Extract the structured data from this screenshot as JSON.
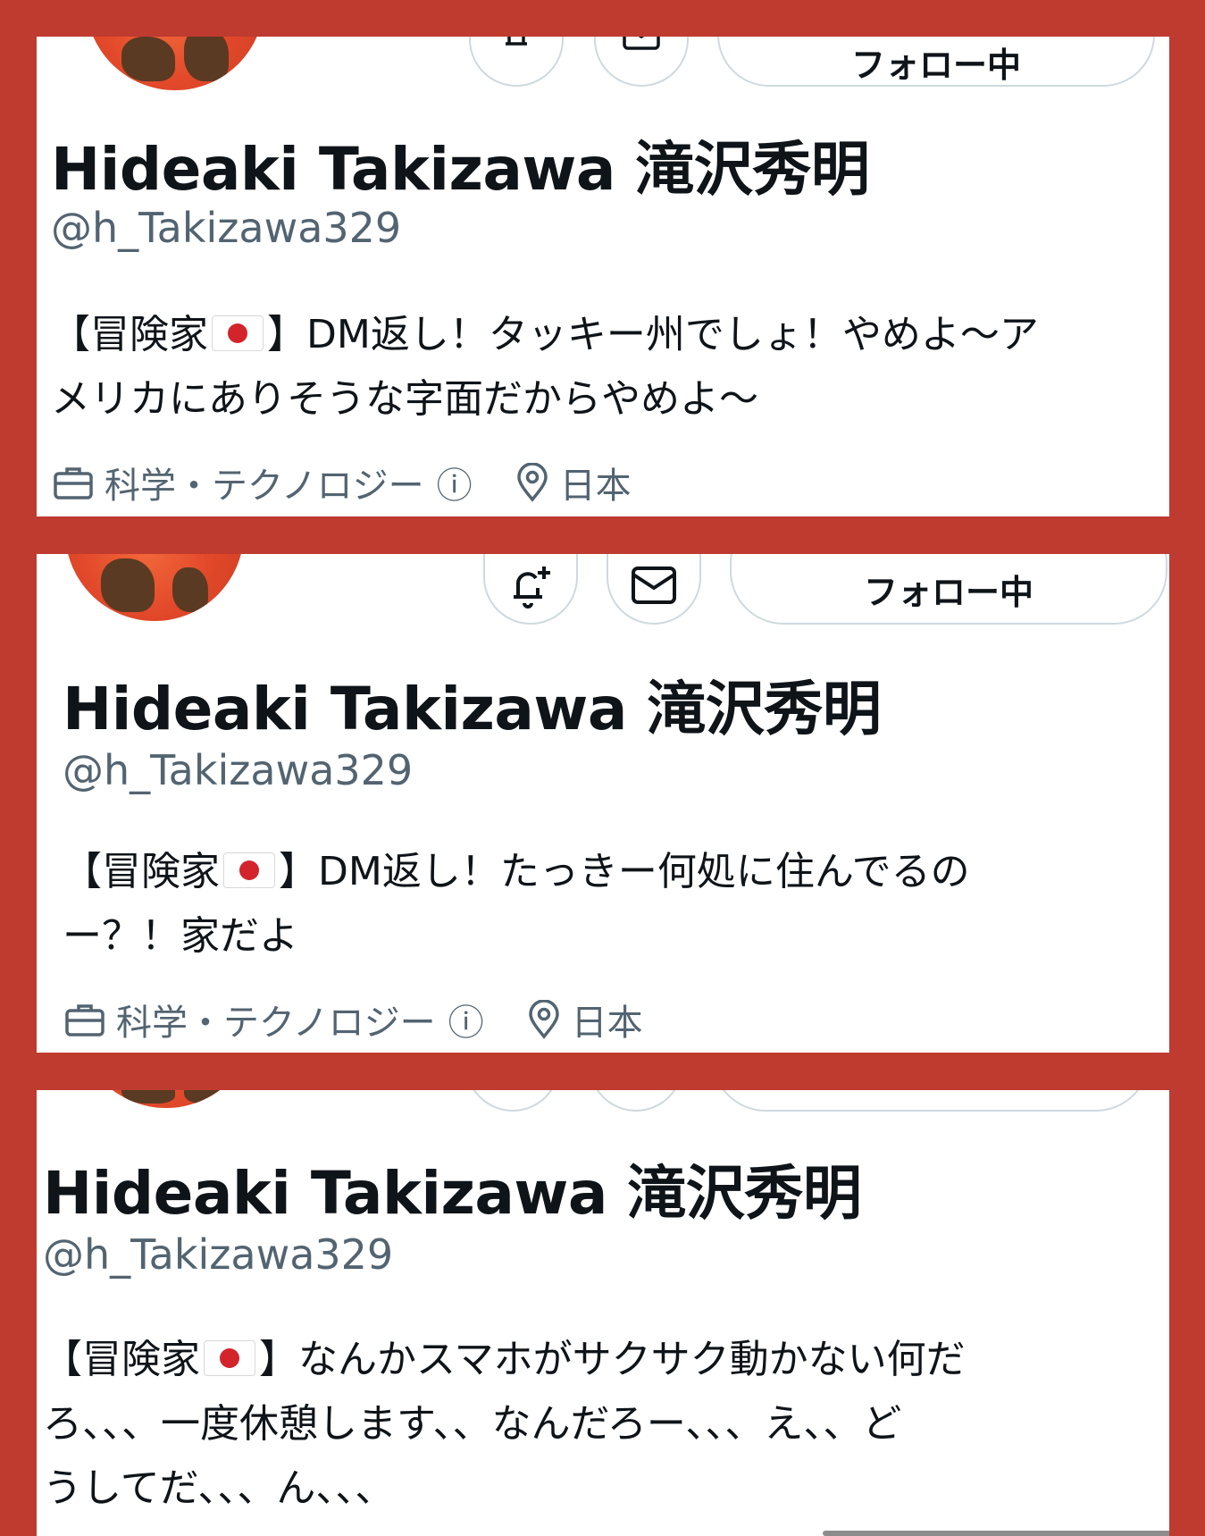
{
  "cards": [
    {
      "name": "Hideaki Takizawa 滝沢秀明",
      "handle": "@h_Takizawa329",
      "bio_prefix": "【冒険家",
      "bio_suffix": "】DM返し！タッキー州でしょ！やめよ〜ア",
      "bio_line2": "メリカにありそうな字面だからやめよ〜",
      "follow_label": "フォロー中",
      "category": "科学・テクノロジー",
      "info": "ⓘ",
      "location": "日本"
    },
    {
      "name": "Hideaki Takizawa 滝沢秀明",
      "handle": "@h_Takizawa329",
      "bio_prefix": "【冒険家",
      "bio_suffix": "】DM返し！たっきー何処に住んでるの",
      "bio_line2": "ー？！家だよ",
      "follow_label": "フォロー中",
      "category": "科学・テクノロジー",
      "info": "ⓘ",
      "location": "日本"
    },
    {
      "name": "Hideaki Takizawa 滝沢秀明",
      "handle": "@h_Takizawa329",
      "bio_prefix": "【冒険家",
      "bio_suffix": "】なんかスマホがサクサク動かない何だ",
      "bio_line2": "ろ、、、一度休憩します、、なんだろー、、、え、、ど",
      "bio_line3": "うしてだ、、、ん、、、"
    }
  ],
  "icons": {
    "notify": "bell-plus-icon",
    "message": "envelope-icon",
    "category": "briefcase-icon",
    "location": "location-pin-icon",
    "flag": "japan-flag"
  },
  "colors": {
    "background": "#bf3b2f",
    "text": "#0f1419",
    "secondary": "#536471",
    "border": "#cfd9de"
  }
}
